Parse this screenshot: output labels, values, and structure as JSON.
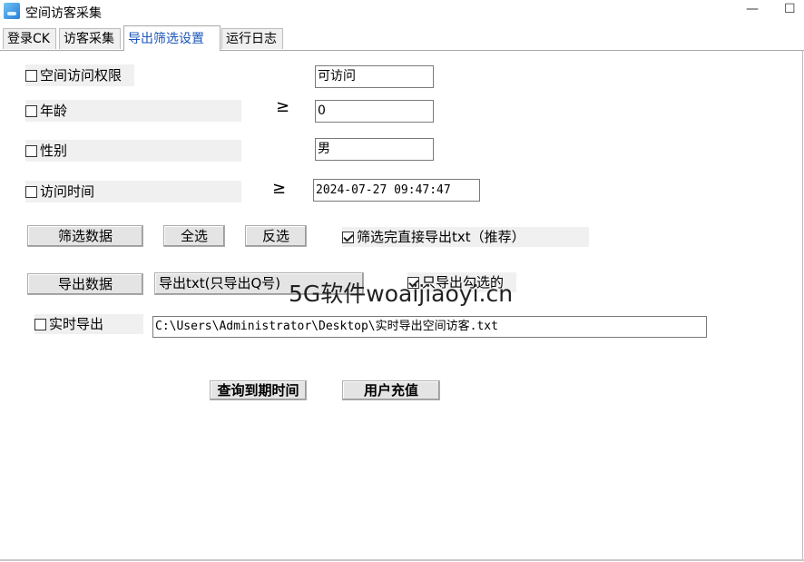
{
  "window": {
    "title": "空间访客采集",
    "minimize": "—",
    "maximize": "☐"
  },
  "tabs": [
    {
      "label": "登录CK"
    },
    {
      "label": "访客采集"
    },
    {
      "label": "导出筛选设置"
    },
    {
      "label": "运行日志"
    }
  ],
  "filters": {
    "access": {
      "label": "空间访问权限",
      "value": "可访问",
      "checked": false
    },
    "age": {
      "label": "年龄",
      "operator": "≥",
      "value": "0",
      "checked": false
    },
    "gender": {
      "label": "性别",
      "value": "男",
      "checked": false
    },
    "visit_time": {
      "label": "访问时间",
      "operator": "≥",
      "value": "2024-07-27 09:47:47",
      "checked": false
    }
  },
  "actions": {
    "filter_data": "筛选数据",
    "select_all": "全选",
    "invert": "反选",
    "export_after_filter": {
      "label": "筛选完直接导出txt（推荐）",
      "checked": true
    },
    "export_data": "导出数据",
    "export_mode": "导出txt(只导出Q号)",
    "only_checked": {
      "label": "只导出勾选的",
      "checked": true
    }
  },
  "realtime": {
    "label": "实时导出",
    "checked": false,
    "path": "C:\\Users\\Administrator\\Desktop\\实时导出空间访客.txt"
  },
  "footer_buttons": {
    "query_expiry": "查询到期时间",
    "recharge": "用户充值"
  },
  "watermark": "5G软件woaijiaoyi.cn"
}
